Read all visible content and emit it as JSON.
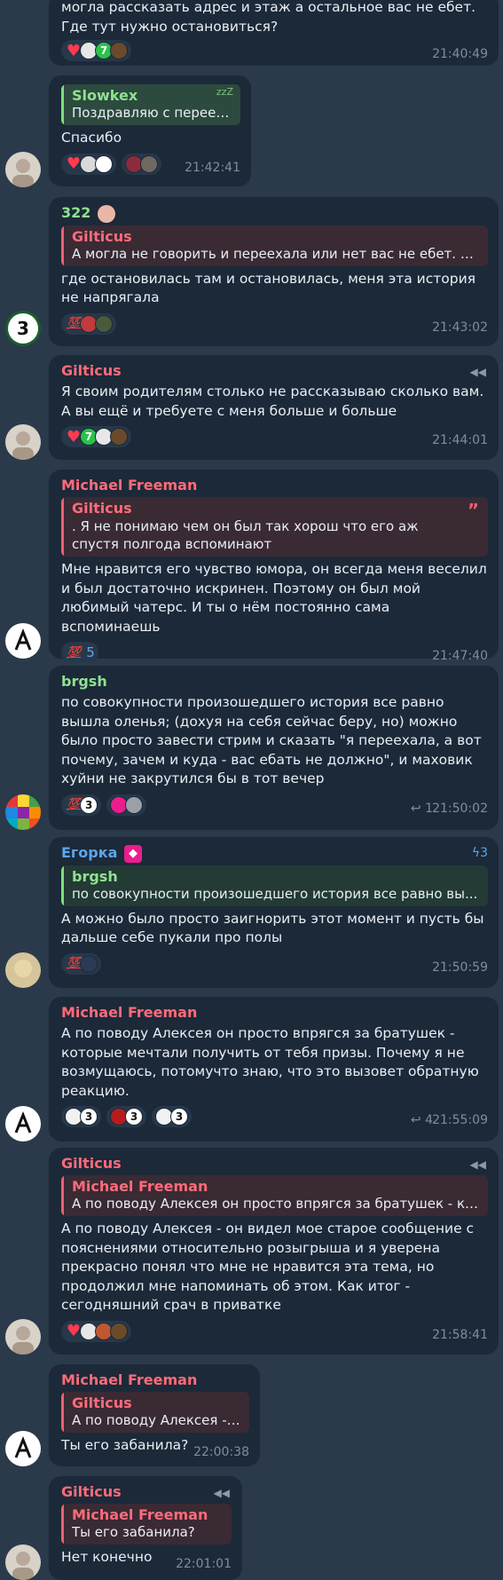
{
  "messages": [
    {
      "id": "m1",
      "text": "могла рассказать адрес и этаж а остальное вас не ебет. Где тут нужно остановиться?",
      "time": "21:40:49"
    },
    {
      "id": "m2",
      "reply_name": "Slowkex",
      "reply_text": "Поздравляю с переез...",
      "text": "Спасибо",
      "time": "21:42:41"
    },
    {
      "id": "m3",
      "sender": "322",
      "reply_name": "Gilticus",
      "reply_text": "А могла не говорить и переехала или нет вас не ебет. А ...",
      "text": "где остановилась там и остановилась, меня эта история не напрягала",
      "reactions_label": "💯",
      "time": "21:43:02"
    },
    {
      "id": "m4",
      "sender": "Gilticus",
      "text": "Я своим родителям столько не рассказываю сколько вам. А вы ещё и требуете с меня больше и больше",
      "time": "21:44:01"
    },
    {
      "id": "m5",
      "sender": "Michael Freeman",
      "reply_name": "Gilticus",
      "reply_text": ". Я не понимаю чем он был так хорош что его аж спустя полгода вспоминают",
      "text": "Мне нравится его чувство юмора, он всегда меня веселил и был достаточно искринен. Поэтому он был мой любимый чатерс. И ты о нём постоянно сама вспоминаешь",
      "reactions_label": "💯",
      "reaction_count": "5",
      "time": "21:47:40"
    },
    {
      "id": "m6",
      "sender": "brgsh",
      "text": "по совокупности произошедшего история все равно вышла оленья; (дохуя на себя сейчас беру, но) можно было просто завести стрим и сказать \"я переехала, а вот почему, зачем и куда - вас ебать не должно\", и маховик хуйни не закрутился бы в тот вечер",
      "reactions_label": "💯",
      "replies": "1",
      "time": "21:50:02"
    },
    {
      "id": "m7",
      "sender": "Егорка",
      "boost": "3",
      "reply_name": "brgsh",
      "reply_text": "по совокупности произошедшего история все равно вы...",
      "text": "А можно было просто заигнорить этот момент и пусть бы дальше себе пукали про полы",
      "reactions_label": "💯",
      "time": "21:50:59"
    },
    {
      "id": "m8",
      "sender": "Michael Freeman",
      "text": "А по поводу Алексея он просто впрягся за братушек - которые мечтали получить от тебя призы. Почему я не возмущаюсь, потомучто знаю, что это вызовет обратную реакцию.",
      "replies": "4",
      "time": "21:55:09"
    },
    {
      "id": "m9",
      "sender": "Gilticus",
      "reply_name": "Michael Freeman",
      "reply_text": "А по поводу Алексея он просто впрягся за братушек - ко...",
      "text": "А по поводу Алексея - он видел мое старое сообщение с пояснениями относительно розыгрыша и я уверена прекрасно понял что мне не нравится эта тема, но продолжил мне напоминать об этом. Как итог - сегодняшний срач в приватке",
      "time": "21:58:41"
    },
    {
      "id": "m10",
      "sender": "Michael Freeman",
      "reply_name": "Gilticus",
      "reply_text": "А по поводу Алексея - ...",
      "text": "Ты его забанила?",
      "time": "22:00:38"
    },
    {
      "id": "m11",
      "sender": "Gilticus",
      "reply_name": "Michael Freeman",
      "reply_text": "Ты его забанила?",
      "text": "Нет конечно",
      "time": "22:01:01"
    }
  ],
  "colors": {
    "background": "#2a3a4b",
    "bubble": "#1c2938",
    "sender_red": "#ff6b7a",
    "sender_green": "#8fe28f",
    "sender_blue": "#5aa6ee"
  }
}
